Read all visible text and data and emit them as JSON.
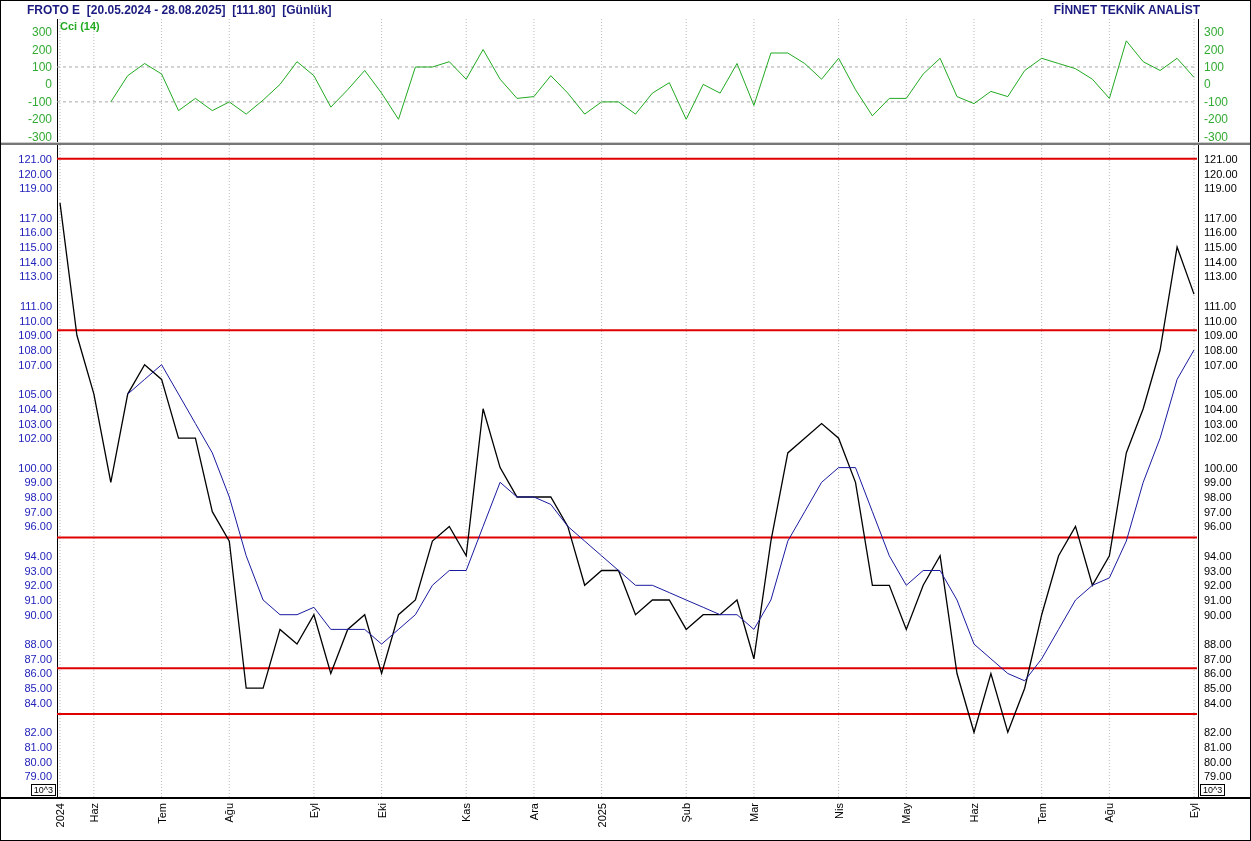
{
  "header": {
    "title": "FROTO E  [20.05.2024 - 28.08.2025]  [111.80]  [Günlük]",
    "brand": "FİNNET TEKNİK ANALİST"
  },
  "indicator_panel": {
    "chart_data": {
      "type": "line",
      "grid": true,
      "ylim": [
        -330,
        375
      ],
      "yticks": [
        {
          "value": 300,
          "label": "300"
        },
        {
          "value": 200,
          "label": "200"
        },
        {
          "value": 100,
          "label": "100"
        },
        {
          "value": 0,
          "label": "0"
        },
        {
          "value": -100,
          "label": "-100"
        },
        {
          "value": -200,
          "label": "-200"
        },
        {
          "value": -300,
          "label": "-300"
        }
      ],
      "categories": [
        null,
        null,
        null,
        null,
        null,
        null,
        null,
        null,
        null,
        null,
        null,
        null,
        null,
        null,
        null,
        null,
        null,
        null,
        null,
        null,
        null,
        null,
        null,
        null,
        null,
        null,
        null,
        null,
        null,
        null,
        null,
        null,
        null,
        null,
        null,
        null,
        null,
        null,
        null,
        null,
        null,
        null,
        null,
        null,
        null,
        null,
        null,
        null,
        null,
        null,
        null,
        null,
        null,
        null,
        null,
        null,
        null,
        null,
        null,
        null,
        null,
        null,
        null,
        null,
        null,
        null,
        null,
        null
      ],
      "series": [
        {
          "name": "Cci (14)",
          "color": "#22aa22",
          "values": [
            null,
            null,
            null,
            -100,
            50,
            120,
            60,
            -150,
            -80,
            -150,
            -100,
            -170,
            -90,
            0,
            130,
            50,
            -130,
            -30,
            80,
            -50,
            -200,
            100,
            100,
            130,
            30,
            200,
            30,
            -80,
            -70,
            50,
            -50,
            -170,
            -100,
            -100,
            -170,
            -50,
            10,
            -200,
            0,
            -50,
            120,
            -120,
            180,
            180,
            120,
            30,
            150,
            -30,
            -180,
            -80,
            -80,
            60,
            150,
            -70,
            -110,
            -40,
            -70,
            80,
            150,
            120,
            90,
            30,
            -80,
            250,
            130,
            80,
            150,
            40
          ]
        }
      ]
    }
  },
  "price_panel": {
    "chart_data": {
      "type": "line",
      "ylim": [
        77.6,
        121.94
      ],
      "categories": [
        "2024",
        null,
        "Haz",
        null,
        null,
        null,
        "Tem",
        null,
        null,
        null,
        "Ağu",
        null,
        null,
        null,
        null,
        "Eyl",
        null,
        null,
        null,
        "Eki",
        null,
        null,
        null,
        null,
        "Kas",
        null,
        null,
        null,
        "Ara",
        null,
        null,
        null,
        "2025",
        null,
        null,
        null,
        null,
        "Şub",
        null,
        null,
        null,
        "Mar",
        null,
        null,
        null,
        null,
        "Nis",
        null,
        null,
        null,
        "May",
        null,
        null,
        null,
        "Haz",
        null,
        null,
        null,
        "Tem",
        null,
        null,
        null,
        "Ağu",
        null,
        null,
        null,
        null,
        "Eyl"
      ],
      "series": [
        {
          "color": "#000000",
          "values": [
            118,
            109,
            105,
            99,
            105,
            107,
            106,
            102,
            102,
            97,
            95,
            85,
            85,
            89,
            88,
            90,
            86,
            89,
            90,
            86,
            90,
            91,
            95,
            96,
            94,
            104,
            100,
            98,
            98,
            98,
            96,
            92,
            93,
            93,
            90,
            91,
            91,
            89,
            90,
            90,
            91,
            87,
            95,
            101,
            102,
            103,
            102,
            99,
            92,
            92,
            89,
            92,
            94,
            86,
            82,
            86,
            82,
            85,
            90,
            94,
            96,
            92,
            94,
            101,
            104,
            108,
            115,
            111.8
          ]
        },
        {
          "color": "#1a1aa0",
          "values": [
            null,
            null,
            null,
            null,
            105,
            106,
            107,
            105,
            103,
            101,
            98,
            94,
            91,
            90,
            90,
            90.5,
            89,
            89,
            89,
            88,
            89,
            90,
            92,
            93,
            93,
            96,
            99,
            98,
            98,
            97.5,
            96,
            95,
            94,
            93,
            92,
            92,
            91.5,
            91,
            90.5,
            90,
            90,
            89,
            91,
            95,
            97,
            99,
            100,
            100,
            97,
            94,
            92,
            93,
            93,
            91,
            88,
            87,
            86,
            85.5,
            87,
            89,
            91,
            92,
            92.5,
            95,
            99,
            102,
            106,
            108
          ]
        }
      ],
      "yticks": [
        {
          "value": 121,
          "label": "121.00"
        },
        {
          "value": 120,
          "label": "120.00"
        },
        {
          "value": 119,
          "label": "119.00"
        },
        {
          "value": 117,
          "label": "117.00"
        },
        {
          "value": 116,
          "label": "116.00"
        },
        {
          "value": 115,
          "label": "115.00"
        },
        {
          "value": 114,
          "label": "114.00"
        },
        {
          "value": 113,
          "label": "113.00"
        },
        {
          "value": 111,
          "label": "111.00"
        },
        {
          "value": 110,
          "label": "110.00"
        },
        {
          "value": 109,
          "label": "109.00"
        },
        {
          "value": 108,
          "label": "108.00"
        },
        {
          "value": 107,
          "label": "107.00"
        },
        {
          "value": 105,
          "label": "105.00"
        },
        {
          "value": 104,
          "label": "104.00"
        },
        {
          "value": 103,
          "label": "103.00"
        },
        {
          "value": 102,
          "label": "102.00"
        },
        {
          "value": 100,
          "label": "100.00"
        },
        {
          "value": 99,
          "label": "99.00"
        },
        {
          "value": 98,
          "label": "98.00"
        },
        {
          "value": 97,
          "label": "97.00"
        },
        {
          "value": 96,
          "label": "96.00"
        },
        {
          "value": 94,
          "label": "94.00"
        },
        {
          "value": 93,
          "label": "93.00"
        },
        {
          "value": 92,
          "label": "92.00"
        },
        {
          "value": 91,
          "label": "91.00"
        },
        {
          "value": 90,
          "label": "90.00"
        },
        {
          "value": 88,
          "label": "88.00"
        },
        {
          "value": 87,
          "label": "87.00"
        },
        {
          "value": 86,
          "label": "86.00"
        },
        {
          "value": 85,
          "label": "85.00"
        },
        {
          "value": 84,
          "label": "84.00"
        },
        {
          "value": 82,
          "label": "82.00"
        },
        {
          "value": 81,
          "label": "81.00"
        },
        {
          "value": 80,
          "label": "80.00"
        },
        {
          "value": 79,
          "label": "79.00"
        }
      ],
      "grid": true,
      "ref_lines": [
        {
          "axis": "y",
          "value": 121.0,
          "color": "#e00000"
        },
        {
          "axis": "y",
          "value": 109.35,
          "color": "#e00000"
        },
        {
          "axis": "y",
          "value": 95.25,
          "color": "#e00000"
        },
        {
          "axis": "y",
          "value": 86.35,
          "color": "#e00000"
        },
        {
          "axis": "y",
          "value": 83.25,
          "color": "#e00000"
        }
      ]
    },
    "scale_badges": [
      "10^3",
      "10^3"
    ]
  }
}
